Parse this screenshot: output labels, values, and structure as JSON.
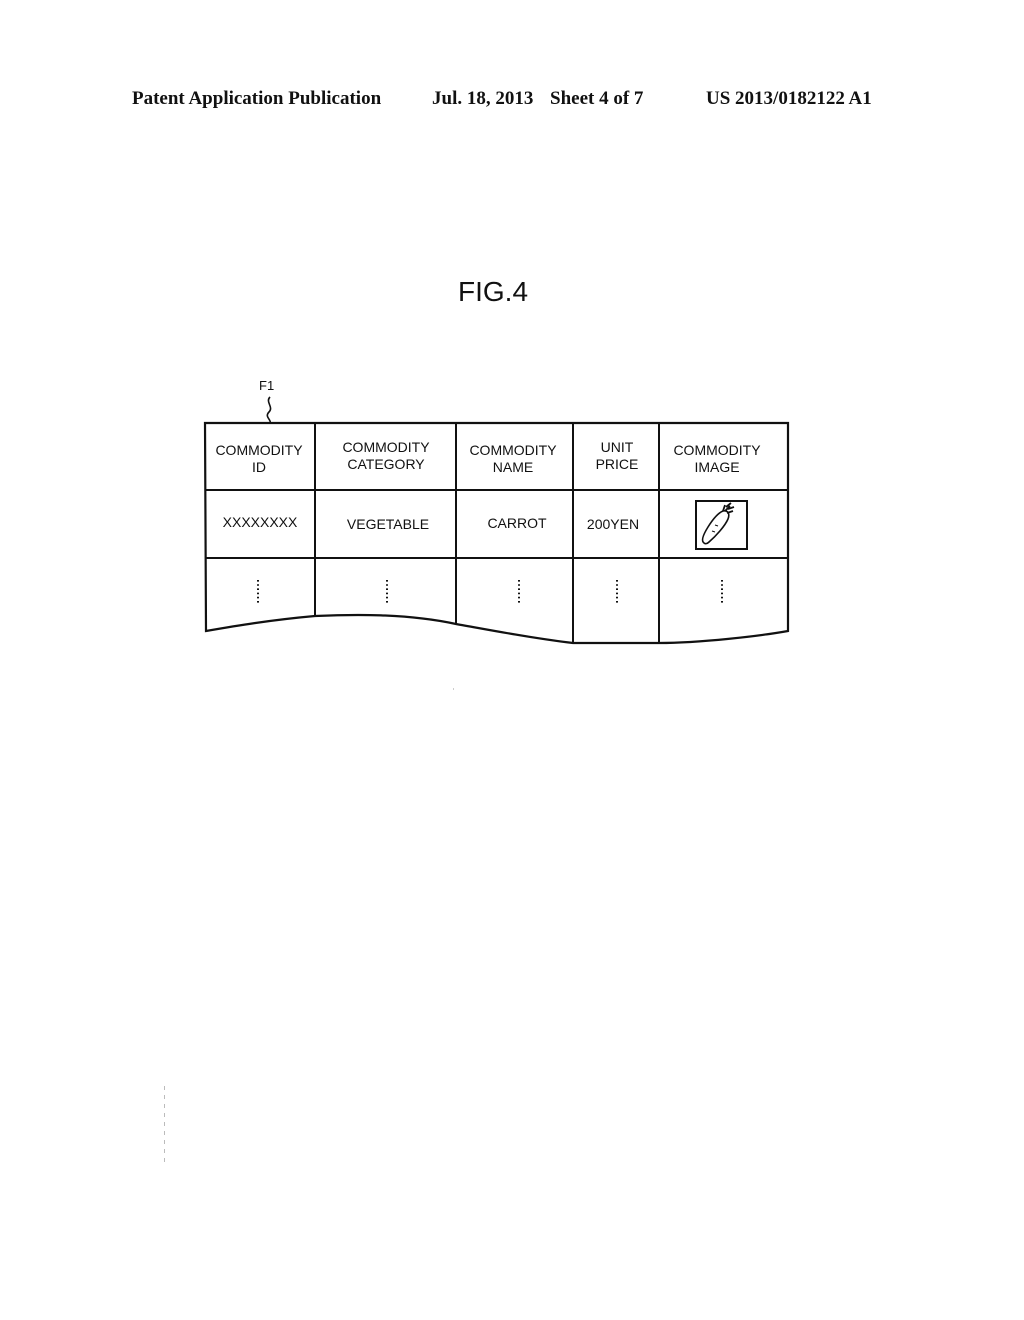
{
  "header": {
    "publication_type": "Patent Application Publication",
    "date": "Jul. 18, 2013",
    "sheet": "Sheet 4 of 7",
    "patent_number": "US 2013/0182122 A1"
  },
  "figure": {
    "title": "FIG.4",
    "reference_label": "F1"
  },
  "table": {
    "columns": [
      {
        "line1": "COMMODITY",
        "line2": "ID"
      },
      {
        "line1": "COMMODITY",
        "line2": "CATEGORY"
      },
      {
        "line1": "COMMODITY",
        "line2": "NAME"
      },
      {
        "line1": "UNIT",
        "line2": "PRICE"
      },
      {
        "line1": "COMMODITY",
        "line2": "IMAGE"
      }
    ],
    "rows": [
      {
        "commodity_id": "XXXXXXXX",
        "commodity_category": "VEGETABLE",
        "commodity_name": "CARROT",
        "unit_price": "200YEN",
        "commodity_image": "carrot-icon"
      }
    ],
    "continuation_marker": "⋮"
  }
}
